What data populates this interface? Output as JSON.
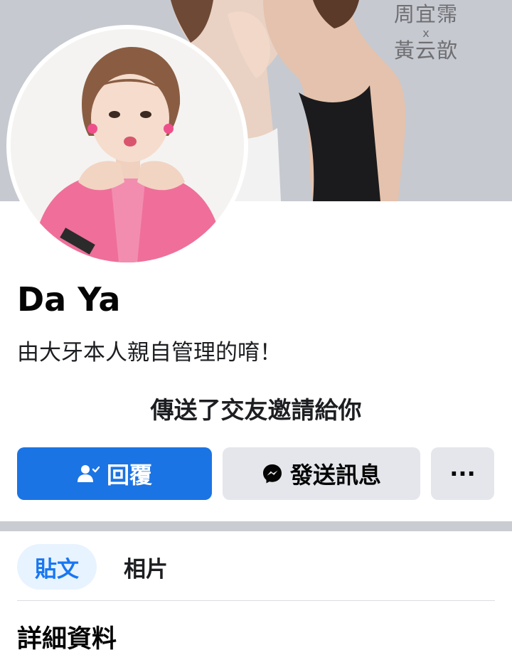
{
  "cover": {
    "caption_name_1": "周宜霈",
    "caption_x": "x",
    "caption_name_2": "黃云歆"
  },
  "profile": {
    "name": "Da Ya",
    "bio": "由大牙本人親自管理的唷！",
    "friend_request_notice": "傳送了交友邀請給你"
  },
  "actions": {
    "respond_label": "回覆",
    "respond_icon": "person-check-icon",
    "message_label": "發送訊息",
    "message_icon": "messenger-icon",
    "more_label": "···",
    "more_icon": "ellipsis-icon"
  },
  "tabs": [
    {
      "label": "貼文",
      "active": true
    },
    {
      "label": "相片",
      "active": false
    }
  ],
  "details": {
    "title": "詳細資料"
  },
  "colors": {
    "primary_blue": "#1b74e4",
    "button_gray": "#e4e6eb",
    "active_tab_bg": "#e7f3ff",
    "active_tab_text": "#1877f2"
  }
}
